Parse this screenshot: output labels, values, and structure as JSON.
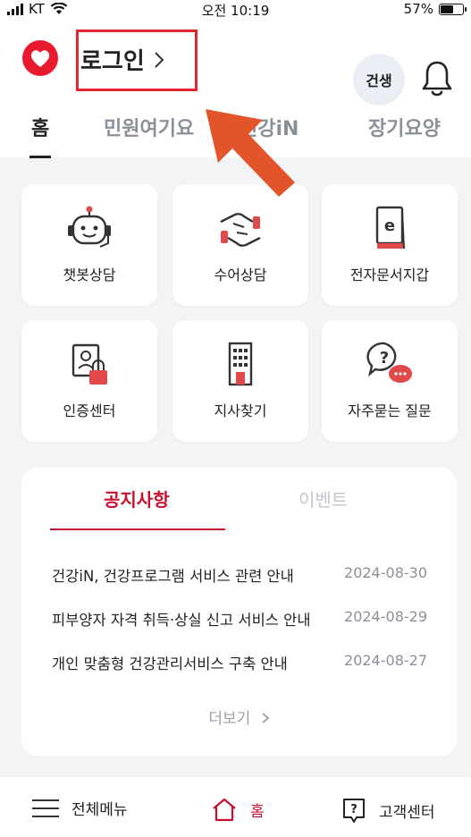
{
  "status_bar": {
    "carrier": "KT",
    "time": "오전 10:19",
    "battery": "57%"
  },
  "header": {
    "login_label": "로그인",
    "avatar_text": "건생"
  },
  "tabs": [
    {
      "label": "홈",
      "active": true
    },
    {
      "label": "민원여기요",
      "active": false
    },
    {
      "label": "건강iN",
      "active": false
    },
    {
      "label": "장기요양",
      "active": false
    }
  ],
  "services": [
    {
      "label": "챗봇상담",
      "icon": "chatbot-icon"
    },
    {
      "label": "수어상담",
      "icon": "sign-language-icon"
    },
    {
      "label": "전자문서지갑",
      "icon": "e-document-wallet-icon"
    },
    {
      "label": "인증센터",
      "icon": "certificate-lock-icon"
    },
    {
      "label": "지사찾기",
      "icon": "building-icon"
    },
    {
      "label": "자주묻는 질문",
      "icon": "faq-speech-icon"
    }
  ],
  "notices": {
    "tab_active": "공지사항",
    "tab_inactive": "이벤트",
    "items": [
      {
        "title": "건강iN, 건강프로그램 서비스 관련 안내",
        "date": "2024-08-30"
      },
      {
        "title": "피부양자 자격 취득·상실 신고 서비스 안내",
        "date": "2024-08-29"
      },
      {
        "title": "개인 맞춤형 건강관리서비스 구축 안내",
        "date": "2024-08-27"
      }
    ],
    "more_label": "더보기"
  },
  "bottom_nav": {
    "menu_label": "전체메뉴",
    "home_label": "홈",
    "support_label": "고객센터"
  },
  "colors": {
    "brand_red": "#c8102e",
    "highlight_box": "#e0262e",
    "arrow": "#e2542a"
  }
}
